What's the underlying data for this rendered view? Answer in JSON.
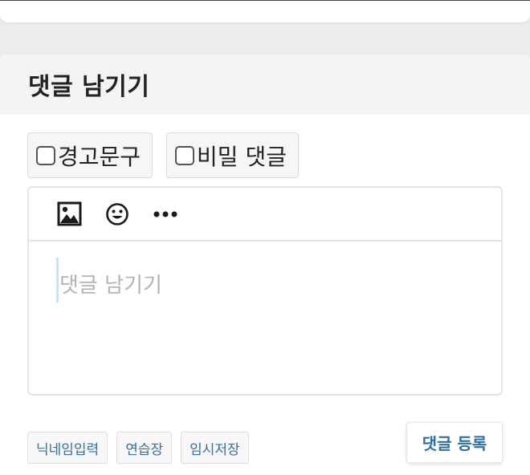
{
  "comment": {
    "title": "댓글 남기기",
    "options": [
      {
        "label": "경고문구",
        "checked": false
      },
      {
        "label": "비밀 댓글",
        "checked": false
      }
    ],
    "toolbar": {
      "icons": [
        "image-icon",
        "emoji-icon",
        "more-icon"
      ]
    },
    "editor": {
      "placeholder": "댓글 남기기",
      "value": ""
    },
    "buttons": {
      "nickname": "닉네임입력",
      "practice": "연습장",
      "draft": "임시저장",
      "submit": "댓글 등록"
    },
    "colors": {
      "accent": "#2e6fa8",
      "link": "#3a6e9e",
      "placeholder": "#b4b4b4",
      "caret": "#cfe0f3"
    }
  }
}
